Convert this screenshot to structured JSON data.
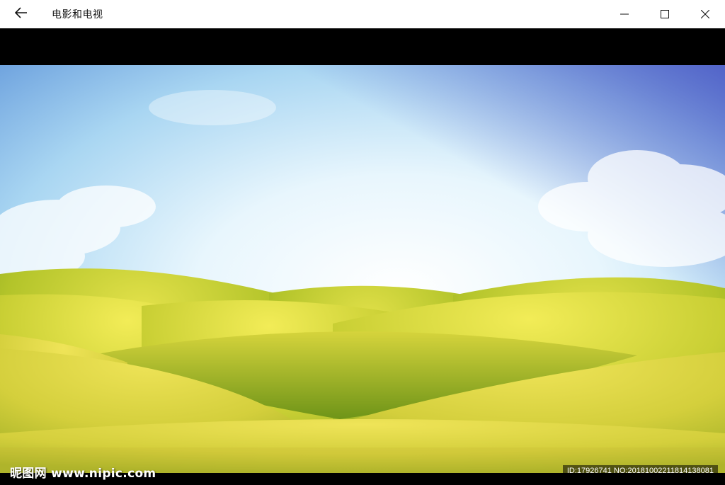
{
  "window": {
    "title": "电影和电视"
  },
  "icons": {
    "back": "back-arrow-icon",
    "minimize": "minimize-icon",
    "maximize": "maximize-icon",
    "close": "close-icon"
  },
  "video": {
    "watermark_logo": "昵图网 www.nipic.com",
    "watermark_id": "ID:17926741 NO:20181002211814138081"
  },
  "colors": {
    "titlebar_bg": "#ffffff",
    "letterbox": "#000000",
    "sky_top": "#8fc3ea",
    "sky_glow": "#f4fbff",
    "hill_light": "#e6e24a",
    "hill_dark": "#7fa21c"
  }
}
